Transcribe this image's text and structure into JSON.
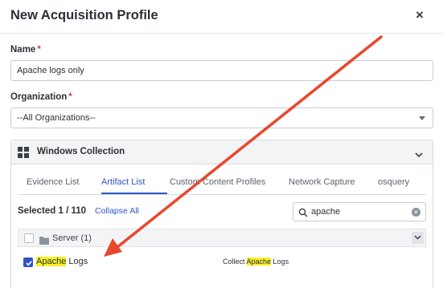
{
  "dialog": {
    "title": "New Acquisition Profile",
    "close_glyph": "×"
  },
  "name_field": {
    "label": "Name",
    "required_mark": "*",
    "value": "Apache logs only"
  },
  "organization_field": {
    "label": "Organization",
    "required_mark": "*",
    "selected": "--All Organizations--"
  },
  "collection_panel": {
    "icon": "windows-icon",
    "title": "Windows Collection",
    "tabs": [
      {
        "label": "Evidence List",
        "active": false
      },
      {
        "label": "Artifact List",
        "active": true
      },
      {
        "label": "Custom Content Profiles",
        "active": false
      },
      {
        "label": "Network Capture",
        "active": false
      },
      {
        "label": "osquery",
        "active": false
      }
    ],
    "selected_count": "Selected 1 / 110",
    "collapse_all": "Collapse All",
    "search": {
      "value": "apache"
    },
    "group": {
      "label": "Server (1)",
      "checked": false
    },
    "items": [
      {
        "name_highlight": "Apache",
        "name_rest": " Logs",
        "desc_prefix": "Collect ",
        "desc_highlight": "Apache",
        "desc_rest": " Logs",
        "checked": true
      }
    ]
  },
  "colors": {
    "accent": "#2f56c9",
    "required": "#e03a3a",
    "highlight": "#f7ef2c",
    "annotation_arrow": "#e8472d"
  }
}
